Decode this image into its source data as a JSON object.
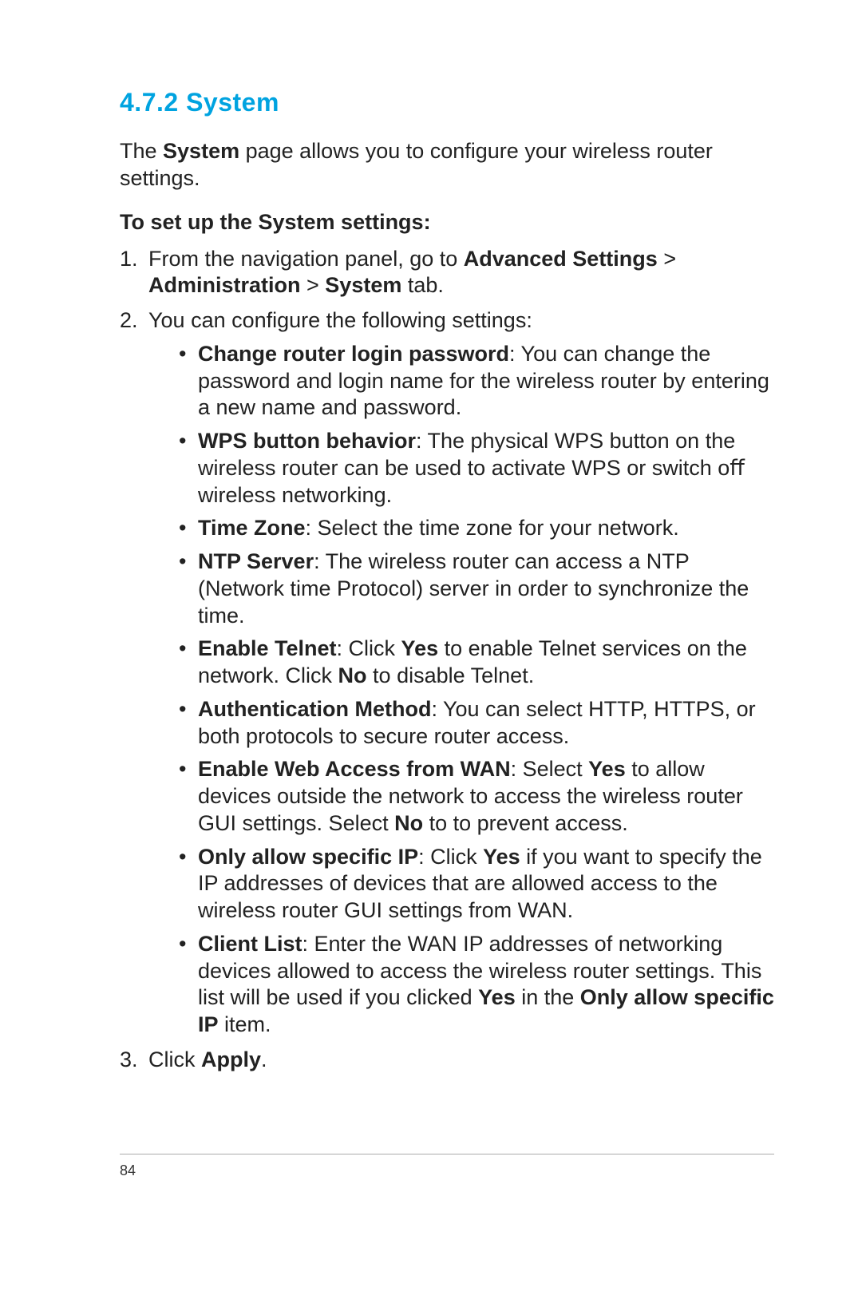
{
  "heading": "4.7.2 System",
  "intro": {
    "pre": "The ",
    "bold1": "System",
    "post": " page allows you to conﬁgure your wireless router settings."
  },
  "subhead": "To set up the System settings:",
  "step1": {
    "pre": "From the navigation panel, go to ",
    "bold1": "Advanced Settings",
    "gt1": " > ",
    "bold2": "Administration",
    "gt2": " > ",
    "bold3": "System",
    "post": " tab."
  },
  "step2": "You can conﬁgure the following settings:",
  "bullets": {
    "b1": {
      "bold": "Change router login password",
      "post": ":  You can change the password and login name for the wireless router by entering a new name and  password."
    },
    "b2": {
      "bold": "WPS button behavior",
      "post": ":  The physical WPS button on the wireless router can be used to activate WPS or switch oﬀ wireless networking."
    },
    "b3": {
      "bold": "Time Zone",
      "post": ":  Select the time zone for your network."
    },
    "b4": {
      "bold": "NTP Server",
      "post": ":  The wireless router can access a NTP (Network time Protocol) server in order to synchronize the time."
    },
    "b5": {
      "bold": "Enable Telnet",
      "pre2": ":  Click ",
      "bold2": "Yes",
      "mid": " to enable Telnet services on the network. Click ",
      "bold3": "No",
      "post": " to disable Telnet."
    },
    "b6": {
      "bold": "Authentication Method",
      "post": ":  You can select HTTP, HTTPS, or both protocols to secure router access."
    },
    "b7": {
      "bold": "Enable Web Access from WAN",
      "pre2": ":  Select ",
      "bold2": "Yes",
      "mid": " to allow devices outside the network to access the wireless router GUI settings. Select ",
      "bold3": "No",
      "post": " to to prevent access."
    },
    "b8": {
      "bold": "Only allow speciﬁc IP",
      "pre2": ":  Click ",
      "bold2": "Yes",
      "post": " if you want to specify the IP addresses of devices that are allowed access to the wireless router GUI settings from WAN."
    },
    "b9": {
      "bold": "Client List",
      "pre2": ":  Enter the WAN IP addresses of networking devices allowed to access the wireless router settings. This list will be used if you clicked ",
      "bold2": "Yes",
      "mid": " in the ",
      "bold3": "Only allow speciﬁc IP",
      "post": " item."
    }
  },
  "step3": {
    "pre": "Click ",
    "bold": "Apply",
    "post": "."
  },
  "page_number": "84"
}
